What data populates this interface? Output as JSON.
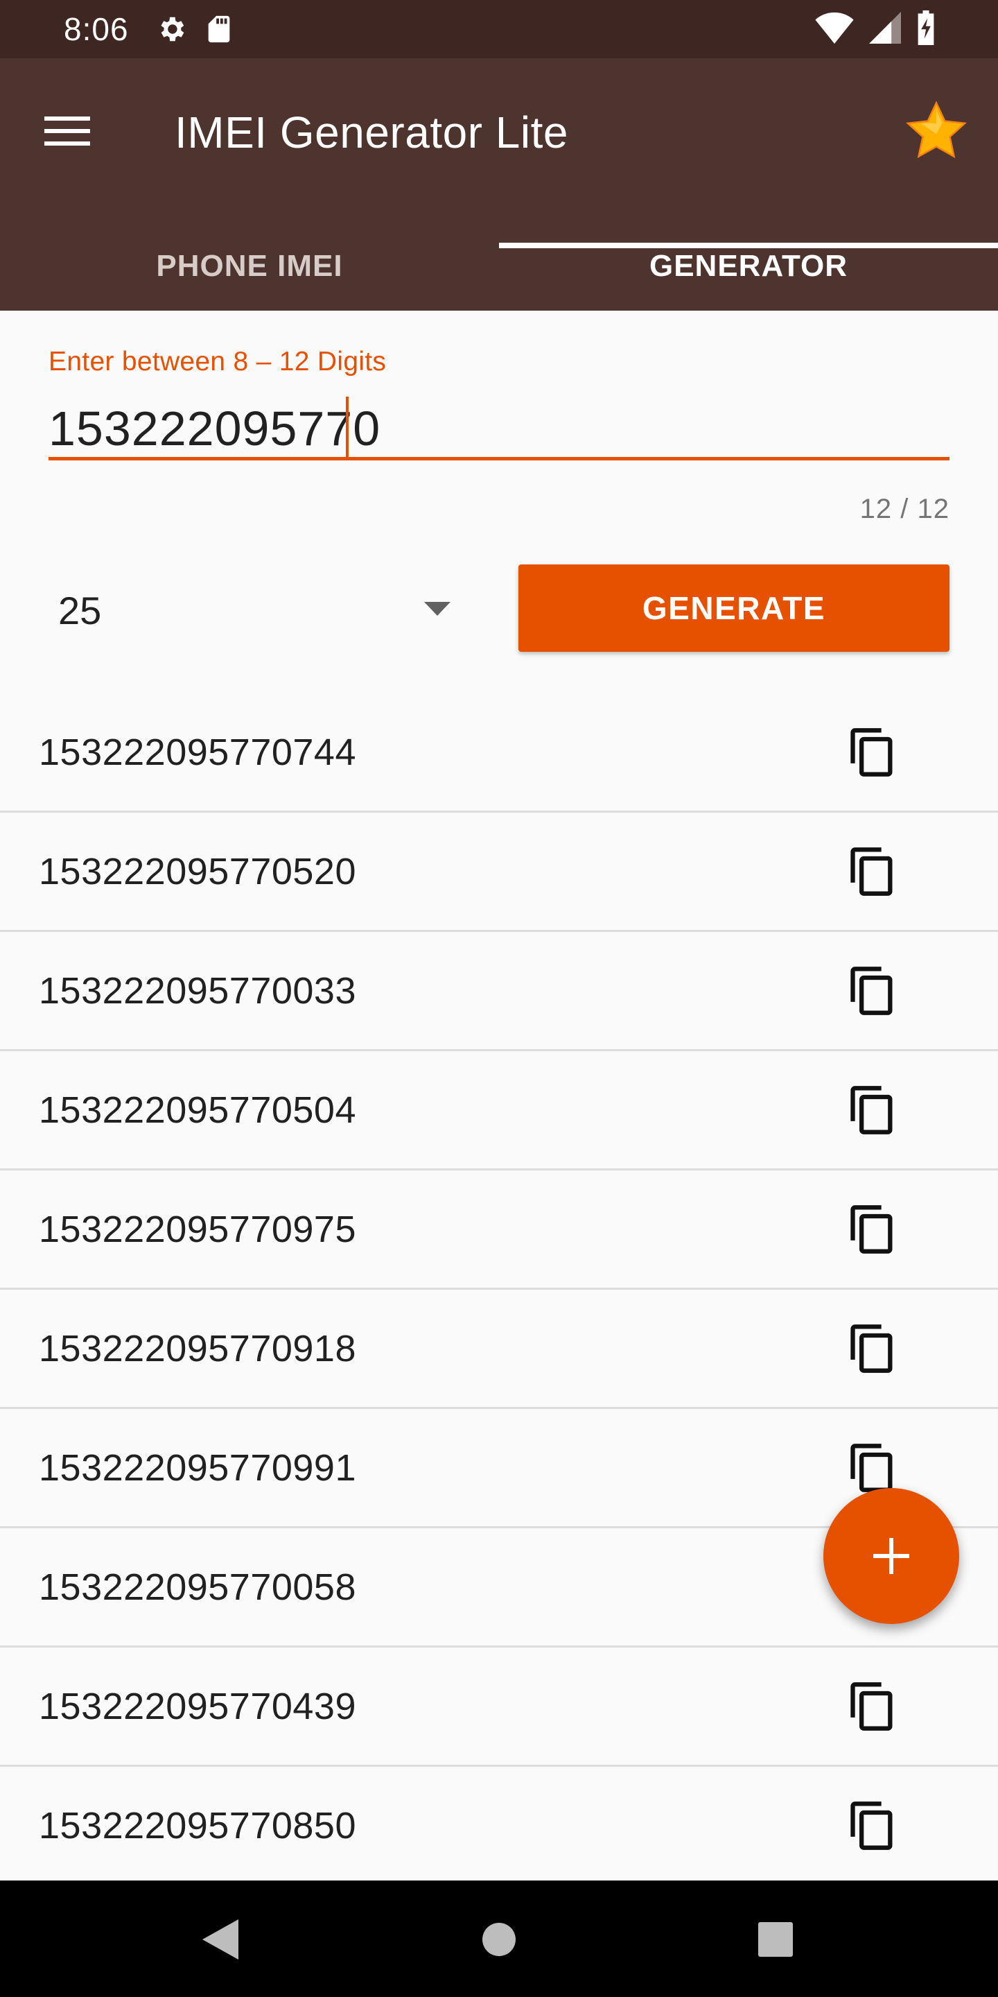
{
  "status_bar": {
    "time": "8:06",
    "left_icons": [
      "gear-icon",
      "sd-card-icon"
    ],
    "right_icons": [
      "wifi-icon",
      "signal-icon",
      "battery-charging-icon"
    ]
  },
  "app_bar": {
    "title": "IMEI Generator Lite",
    "color": "#4e342e",
    "menu_icon": "menu-icon",
    "star_icon": "star-icon"
  },
  "tabs": [
    {
      "label": "PHONE IMEI",
      "active": false
    },
    {
      "label": "GENERATOR",
      "active": true
    }
  ],
  "input": {
    "label": "Enter between 8 – 12 Digits",
    "value": "153222095770",
    "counter": "12 / 12"
  },
  "count_select": {
    "value": "25"
  },
  "generate_button": {
    "label": "GENERATE",
    "color": "#e65100"
  },
  "imei_list": [
    "153222095770744",
    "153222095770520",
    "153222095770033",
    "153222095770504",
    "153222095770975",
    "153222095770918",
    "153222095770991",
    "153222095770058",
    "153222095770439",
    "153222095770850"
  ],
  "fab": {
    "icon": "plus-icon"
  },
  "nav_bar": {
    "icons": [
      "back-icon",
      "home-icon",
      "recents-icon"
    ]
  }
}
